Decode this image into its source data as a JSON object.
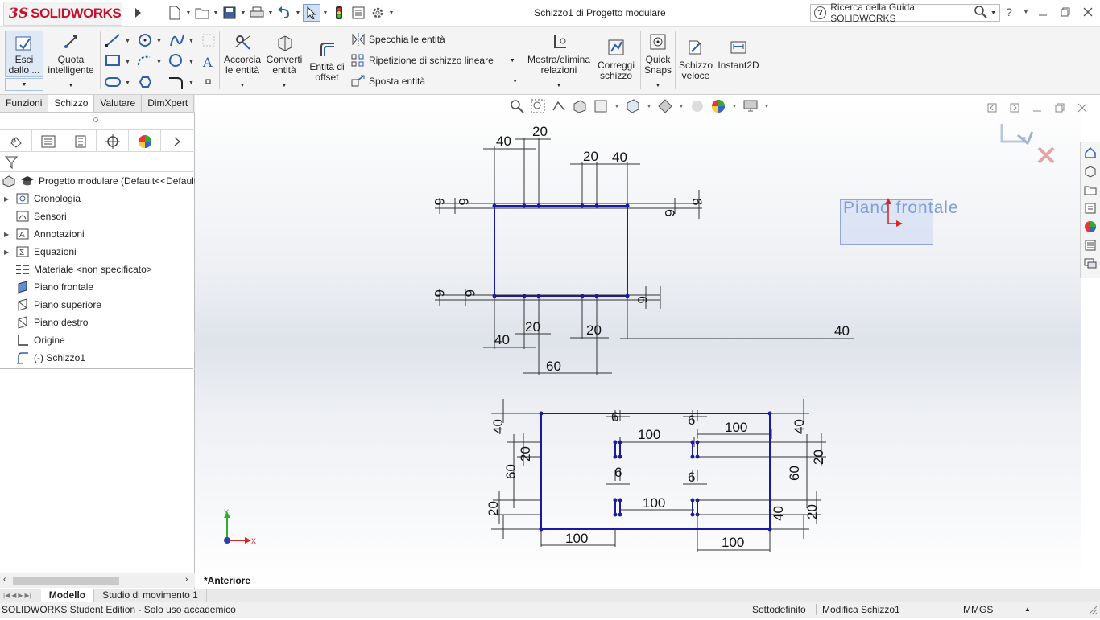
{
  "app": {
    "brand_ds": "3S",
    "brand_name": "SOLIDWORKS",
    "document_title": "Schizzo1 di Progetto modulare",
    "search_placeholder": "Ricerca della Guida SOLIDWORKS"
  },
  "ribbon": {
    "exit_sketch": "Esci dallo ...",
    "smart_dim": "Quota intelligente",
    "trim": "Accorcia le entità",
    "convert": "Converti entità",
    "offset": "Entità di offset",
    "mirror": "Specchia le entità",
    "linear_pattern": "Ripetizione di schizzo lineare",
    "move": "Sposta entità",
    "show_relations": "Mostra/elimina relazioni",
    "repair": "Correggi schizzo",
    "quick_snaps": "Quick Snaps",
    "rapid_sketch": "Schizzo veloce",
    "instant2d": "Instant2D"
  },
  "tabs": [
    "Funzioni",
    "Schizzo",
    "Valutare",
    "DimXpert"
  ],
  "tree": {
    "root": "Progetto modulare  (Default<<Default",
    "items": [
      "Cronologia",
      "Sensori",
      "Annotazioni",
      "Equazioni",
      "Materiale <non specificato>",
      "Piano frontale",
      "Piano superiore",
      "Piano destro",
      "Origine",
      "(-) Schizzo1"
    ]
  },
  "canvas": {
    "plane_label": "Piano frontale",
    "view_name": "*Anteriore",
    "axis_x": "X",
    "axis_y": "Y",
    "dims_top": [
      "40",
      "20",
      "20",
      "40",
      "6",
      "6",
      "6",
      "6",
      "40",
      "20",
      "20",
      "40",
      "60",
      "6",
      "6",
      "6"
    ],
    "dims_bottom": [
      "40",
      "20",
      "60",
      "20",
      "6",
      "100",
      "6",
      "100",
      "40",
      "20",
      "60",
      "20",
      "6",
      "100",
      "6",
      "40",
      "100",
      "100"
    ]
  },
  "bottom_tabs": [
    "Modello",
    "Studio di movimento 1"
  ],
  "status": {
    "edition": "SOLIDWORKS Student Edition - Solo uso accademico",
    "state": "Sottodefinito",
    "editing": "Modifica Schizzo1",
    "units": "MMGS"
  },
  "colors": {
    "accent": "#1f3fa8",
    "brand": "#c8102e",
    "sketch": "#1a1aa0"
  }
}
